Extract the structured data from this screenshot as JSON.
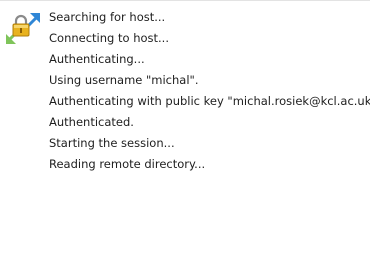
{
  "progress_log": {
    "icon": "connection-lock-icon",
    "lines": [
      "Searching for host...",
      "Connecting to host...",
      "Authenticating...",
      "Using username \"michal\".",
      "Authenticating with public key \"michal.rosiek@kcl.ac.uk\".",
      "Authenticated.",
      "Starting the session...",
      "Reading remote directory..."
    ]
  },
  "colors": {
    "lock_gold": "#e8b21e",
    "arrow_blue": "#2f86d6",
    "arrow_green": "#7fc45a"
  }
}
